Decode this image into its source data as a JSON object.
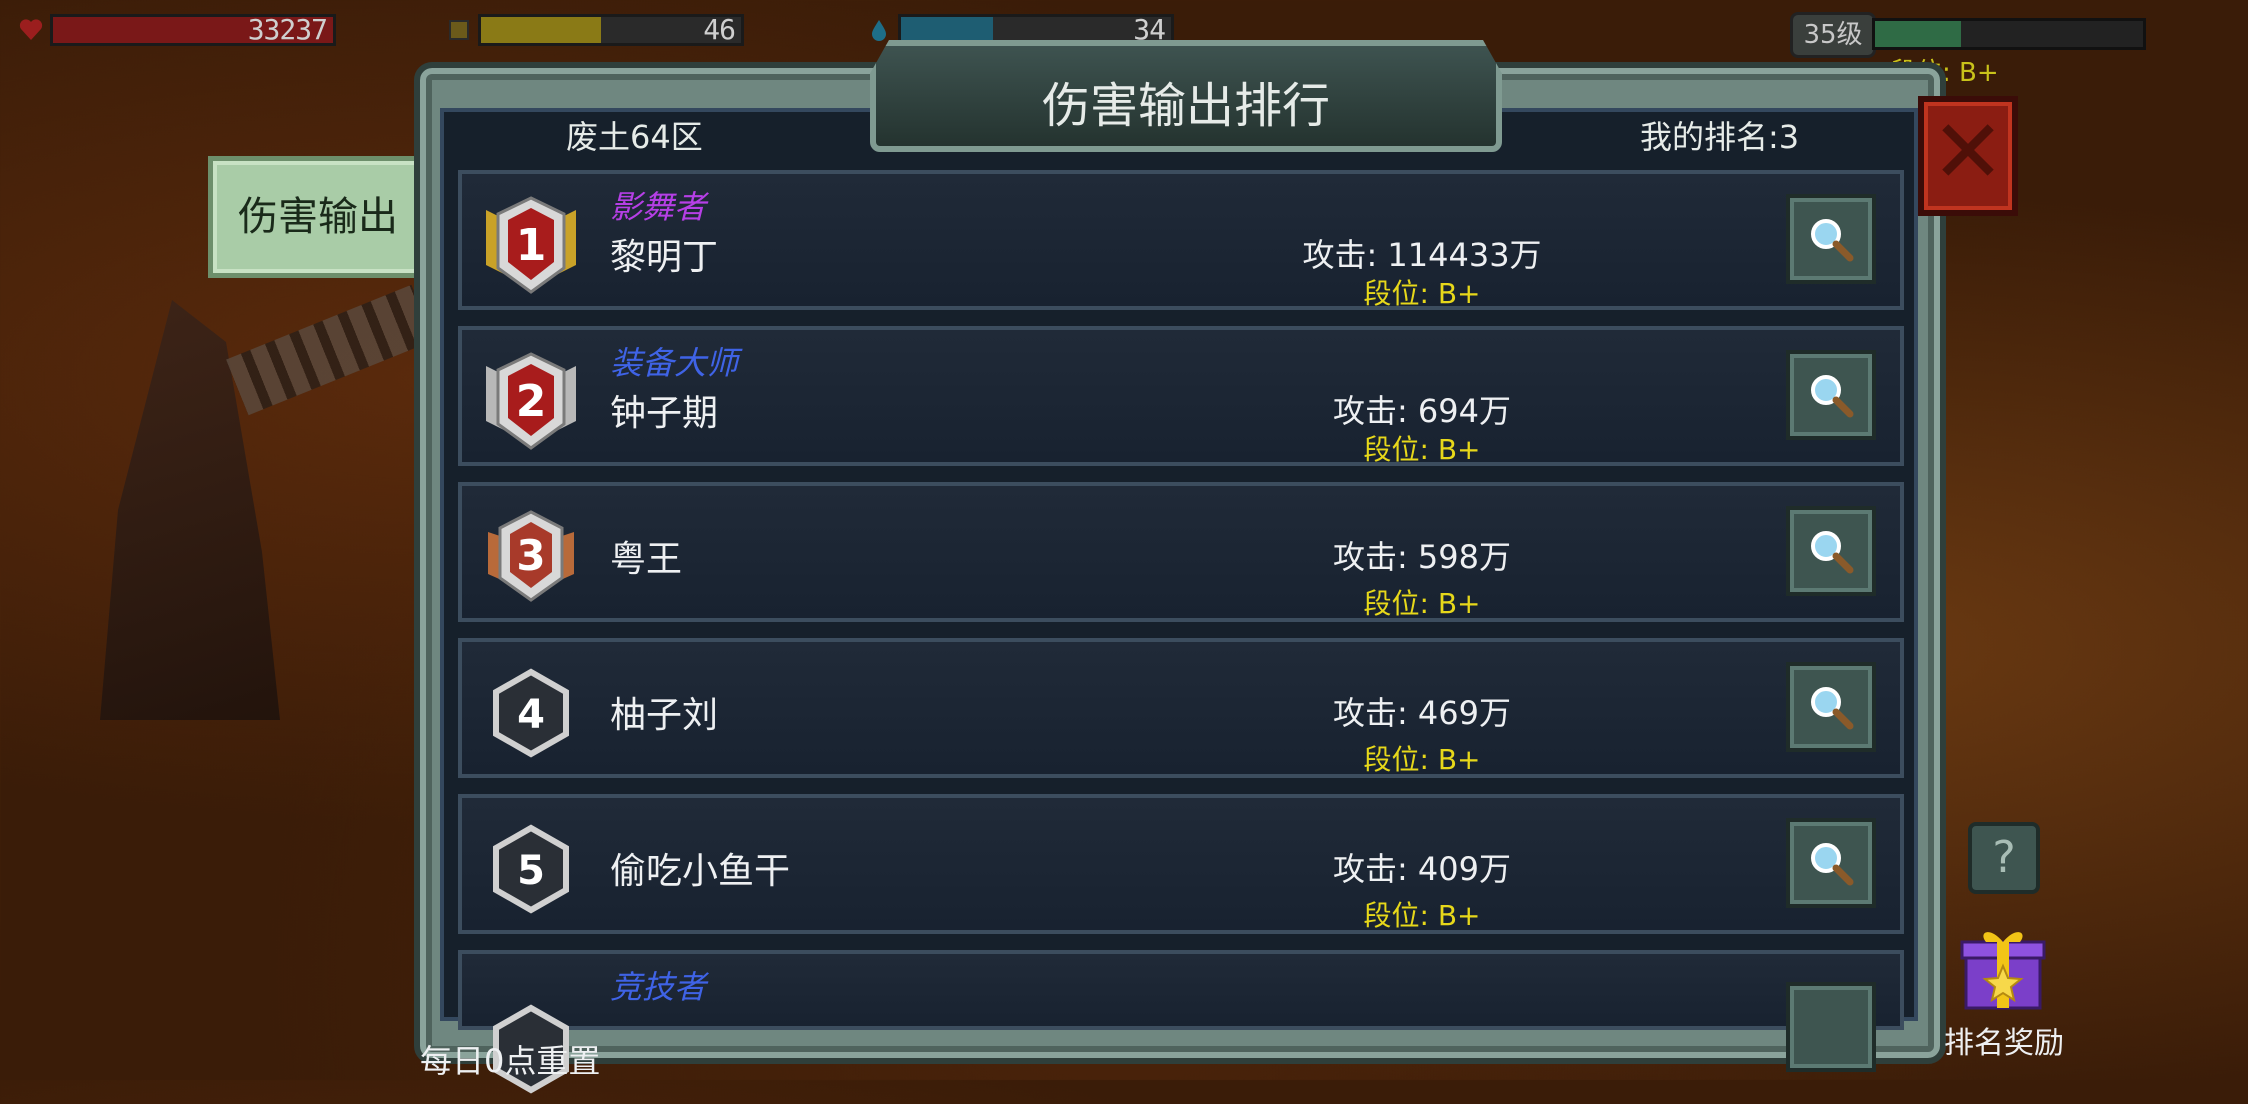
{
  "hud": {
    "hp_value": "33237",
    "energy_value": "46",
    "water_value": "34",
    "level_label": "35级",
    "rank_label": "段位: B+",
    "colors": {
      "hp": "#9b1e1e",
      "energy": "#b59a1a",
      "water": "#1e6e88"
    }
  },
  "panel": {
    "title": "伤害输出排行",
    "server": "废土64区",
    "my_rank": "我的排名:3"
  },
  "side_tab": {
    "label": "伤害输出"
  },
  "rankings": [
    {
      "rank": "1",
      "title": "影舞者",
      "title_color": "#b63fe6",
      "name": "黎明丁",
      "attack": "攻击: 114433万",
      "tier": "段位: B+"
    },
    {
      "rank": "2",
      "title": "装备大师",
      "title_color": "#3f63e6",
      "name": "钟子期",
      "attack": "攻击: 694万",
      "tier": "段位: B+"
    },
    {
      "rank": "3",
      "title": "",
      "title_color": "",
      "name": "粤王",
      "attack": "攻击: 598万",
      "tier": "段位: B+"
    },
    {
      "rank": "4",
      "title": "",
      "title_color": "",
      "name": "柚子刘",
      "attack": "攻击: 469万",
      "tier": "段位: B+"
    },
    {
      "rank": "5",
      "title": "",
      "title_color": "",
      "name": "偷吃小鱼干",
      "attack": "攻击: 409万",
      "tier": "段位: B+"
    },
    {
      "rank": "6",
      "title": "竞技者",
      "title_color": "#3f63e6",
      "name": "",
      "attack": "",
      "tier": ""
    }
  ],
  "footer": {
    "reset_note": "每日0点重置",
    "help_label": "?",
    "reward_label": "排名奖励"
  }
}
